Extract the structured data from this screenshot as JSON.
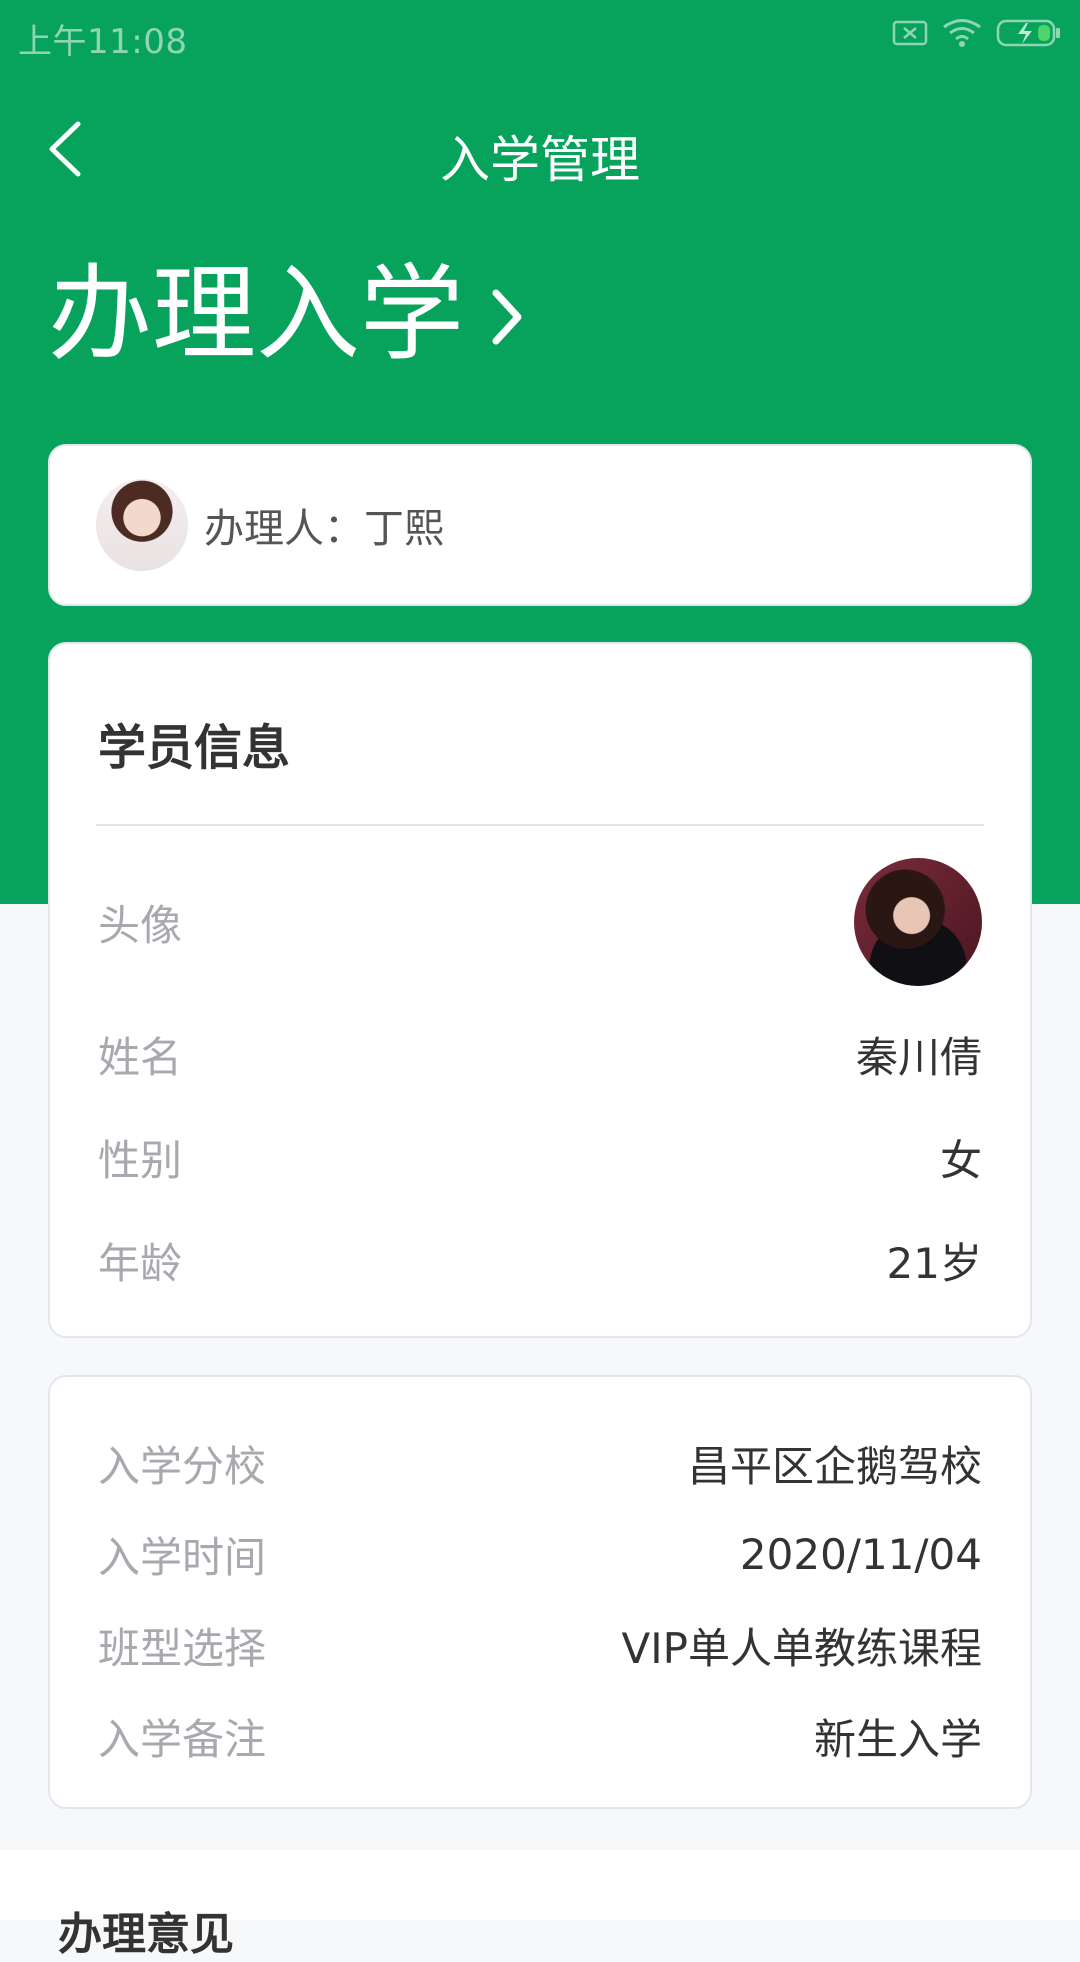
{
  "status_bar": {
    "time": "上午11:08",
    "icons": [
      "sim-error-icon",
      "wifi-icon",
      "battery-charging-icon"
    ]
  },
  "nav": {
    "title": "入学管理",
    "back_icon": "back-arrow-icon"
  },
  "header": {
    "big_title": "办理入学",
    "chevron_icon": "chevron-right-icon"
  },
  "handler": {
    "label": "办理人：丁熙"
  },
  "student": {
    "section_title": "学员信息",
    "avatar_label": "头像",
    "name_label": "姓名",
    "name_value": "秦川倩",
    "gender_label": "性别",
    "gender_value": "女",
    "age_label": "年龄",
    "age_value": "21岁"
  },
  "enrollment": {
    "school_label": "入学分校",
    "school_value": "昌平区企鹅驾校",
    "date_label": "入学时间",
    "date_value": "2020/11/04",
    "class_label": "班型选择",
    "class_value": "VIP单人单教练课程",
    "remark_label": "入学备注",
    "remark_value": "新生入学"
  },
  "opinion": {
    "title": "办理意见"
  },
  "colors": {
    "brand_green": "#07a35c",
    "background": "#f7f8fa",
    "label_gray": "#a7a9ae",
    "text_dark": "#333333"
  }
}
